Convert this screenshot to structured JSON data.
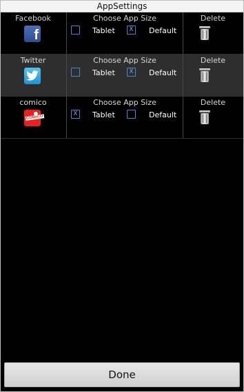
{
  "window": {
    "title": "AppSettings"
  },
  "columns": {
    "size_header": "Choose App Size",
    "delete_label": "Delete",
    "tablet_label": "Tablet",
    "default_label": "Default"
  },
  "apps": [
    {
      "name": "Facebook",
      "icon": "facebook-icon",
      "tablet_checked": false,
      "default_checked": true,
      "tablet_mark": "",
      "default_mark": "X"
    },
    {
      "name": "Twitter",
      "icon": "twitter-icon",
      "tablet_checked": false,
      "default_checked": true,
      "tablet_mark": "",
      "default_mark": "X",
      "selected": true
    },
    {
      "name": "comico",
      "icon": "comico-icon",
      "icon_text": "COMICO",
      "tablet_checked": true,
      "default_checked": false,
      "tablet_mark": "X",
      "default_mark": ""
    }
  ],
  "footer": {
    "done_label": "Done"
  },
  "colors": {
    "checkbox_accent": "#4a86d8",
    "selected_row": "#2e2e2e",
    "facebook": "#3b5998",
    "twitter": "#2aa9e0",
    "comico": "#e8211f"
  }
}
